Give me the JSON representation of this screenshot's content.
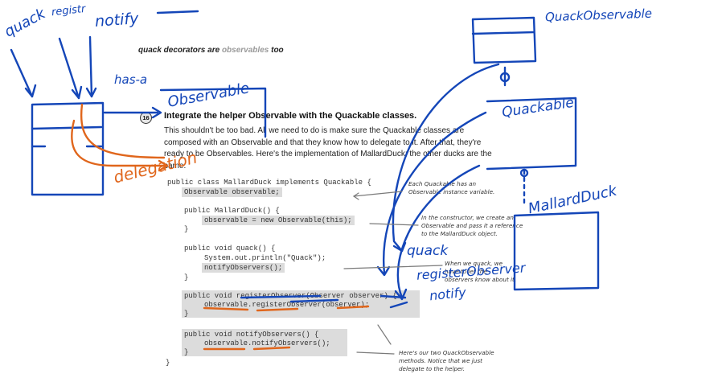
{
  "book": {
    "section_header_prefix": "quack decorators are",
    "section_header_highlight": "observables",
    "section_header_suffix": "too",
    "step_number": "16",
    "step_title": "Integrate the helper Observable with the Quackable classes.",
    "paragraph": "This shouldn't be too bad. All we need to do is make sure the Quackable classes are composed with an Observable and that they know how to delegate to it. After that, they're ready to be Observables. Here's the implementation of MallardDuck; the other ducks are the same.",
    "code": {
      "line1": "public class MallardDuck implements Quackable {",
      "line2": "Observable observable;",
      "line3": "public MallardDuck() {",
      "line4": "observable = new Observable(this);",
      "line5": "}",
      "line6": "public void quack() {",
      "line7": "System.out.println(\"Quack\");",
      "line8": "notifyObservers();",
      "line9": "}",
      "line10": "public void registerObserver(Observer observer) {",
      "line11": "observable.registerObserver(observer);",
      "line12": "}",
      "line13": "public void notifyObservers() {",
      "line14": "observable.notifyObservers();",
      "line15": "}",
      "line16": "}"
    },
    "notes": {
      "note1_l1": "Each Quackable has an",
      "note1_l2": "Observable instance variable.",
      "note2_l1": "In the constructor, we create an",
      "note2_l2": "Observable and pass it a reference",
      "note2_l3": "to the MallardDuck object.",
      "note3_l1": "When we quack, we",
      "note3_l2": "have to let the",
      "note3_l3": "observers know about it.",
      "note4_l1": "Here's our two QuackObservable",
      "note4_l2": "methods. Notice that we just",
      "note4_l3": "delegate to the helper."
    }
  },
  "annotations": {
    "quack": "quack",
    "register": "registr",
    "notify": "notify",
    "has_a": "has-a",
    "observable": "Observable",
    "delegation": "delegation",
    "quack_observable": "QuackObservable",
    "quackable": "Quackable",
    "mallard_duck": "MallardDuck",
    "quack2": "quack",
    "register_observer2": "registerObserver",
    "notify2": "notify"
  },
  "colors": {
    "ink_blue": "#1446b8",
    "ink_orange": "#e0661c",
    "code_highlight": "#dcdcdc"
  }
}
